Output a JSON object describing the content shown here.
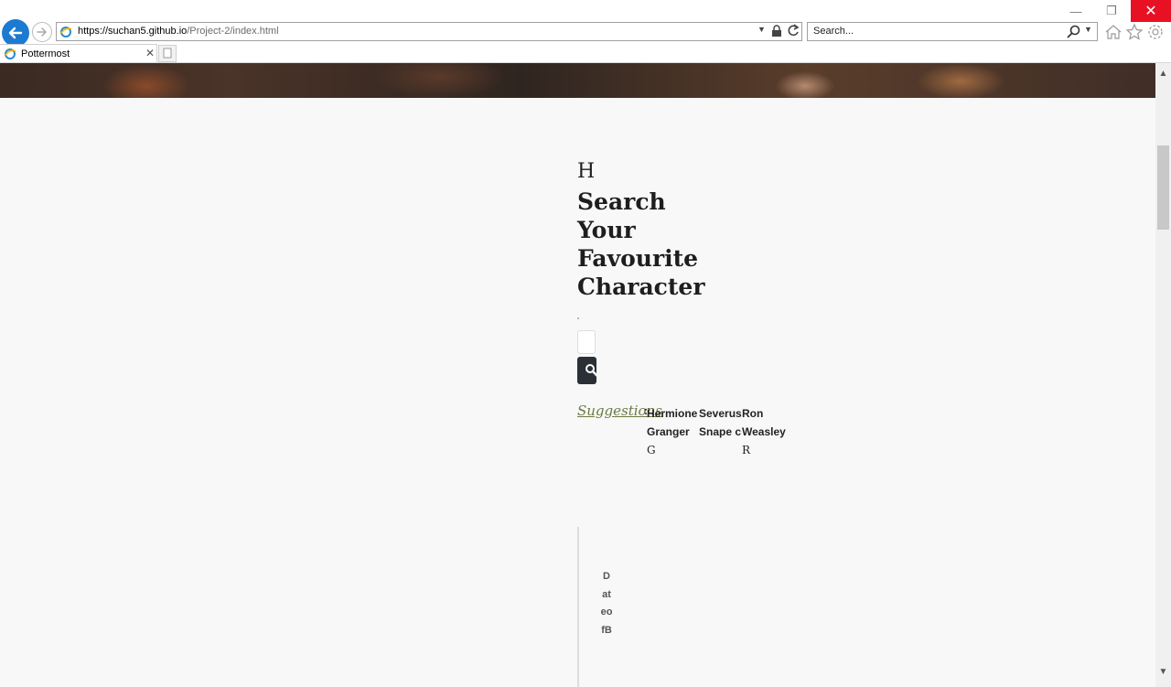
{
  "browser": {
    "url_host": "https://suchan5.github.io",
    "url_path": "/Project-2/index.html",
    "search_placeholder": "Search...",
    "tab_title": "Pottermost",
    "window_close": "✕",
    "window_min": "—",
    "window_max": "❐"
  },
  "page": {
    "initial": "H",
    "title": "Search Your Favourite Character",
    "suggestions_label": "Suggestions",
    "suggestions_colon": ":",
    "suggestions": [
      {
        "name_1": "Hermione",
        "name_2": "Granger",
        "tail": "G"
      },
      {
        "name_1": "Severus",
        "name_2": "Snape c",
        "tail": ""
      },
      {
        "name_1": "Ron",
        "name_2": "Weasley",
        "tail": "R"
      }
    ],
    "timeline_vertical_text": "DateofB"
  },
  "colors": {
    "accent_blue": "#1c7bd1",
    "close_red": "#e81123",
    "search_button": "#2b2f36",
    "suggestion_label": "#6a7a40"
  },
  "icons": [
    "back-arrow-icon",
    "forward-arrow-icon",
    "ie-logo-icon",
    "lock-icon",
    "refresh-icon",
    "search-icon",
    "home-icon",
    "star-icon",
    "gear-icon",
    "new-tab-icon",
    "close-icon"
  ]
}
